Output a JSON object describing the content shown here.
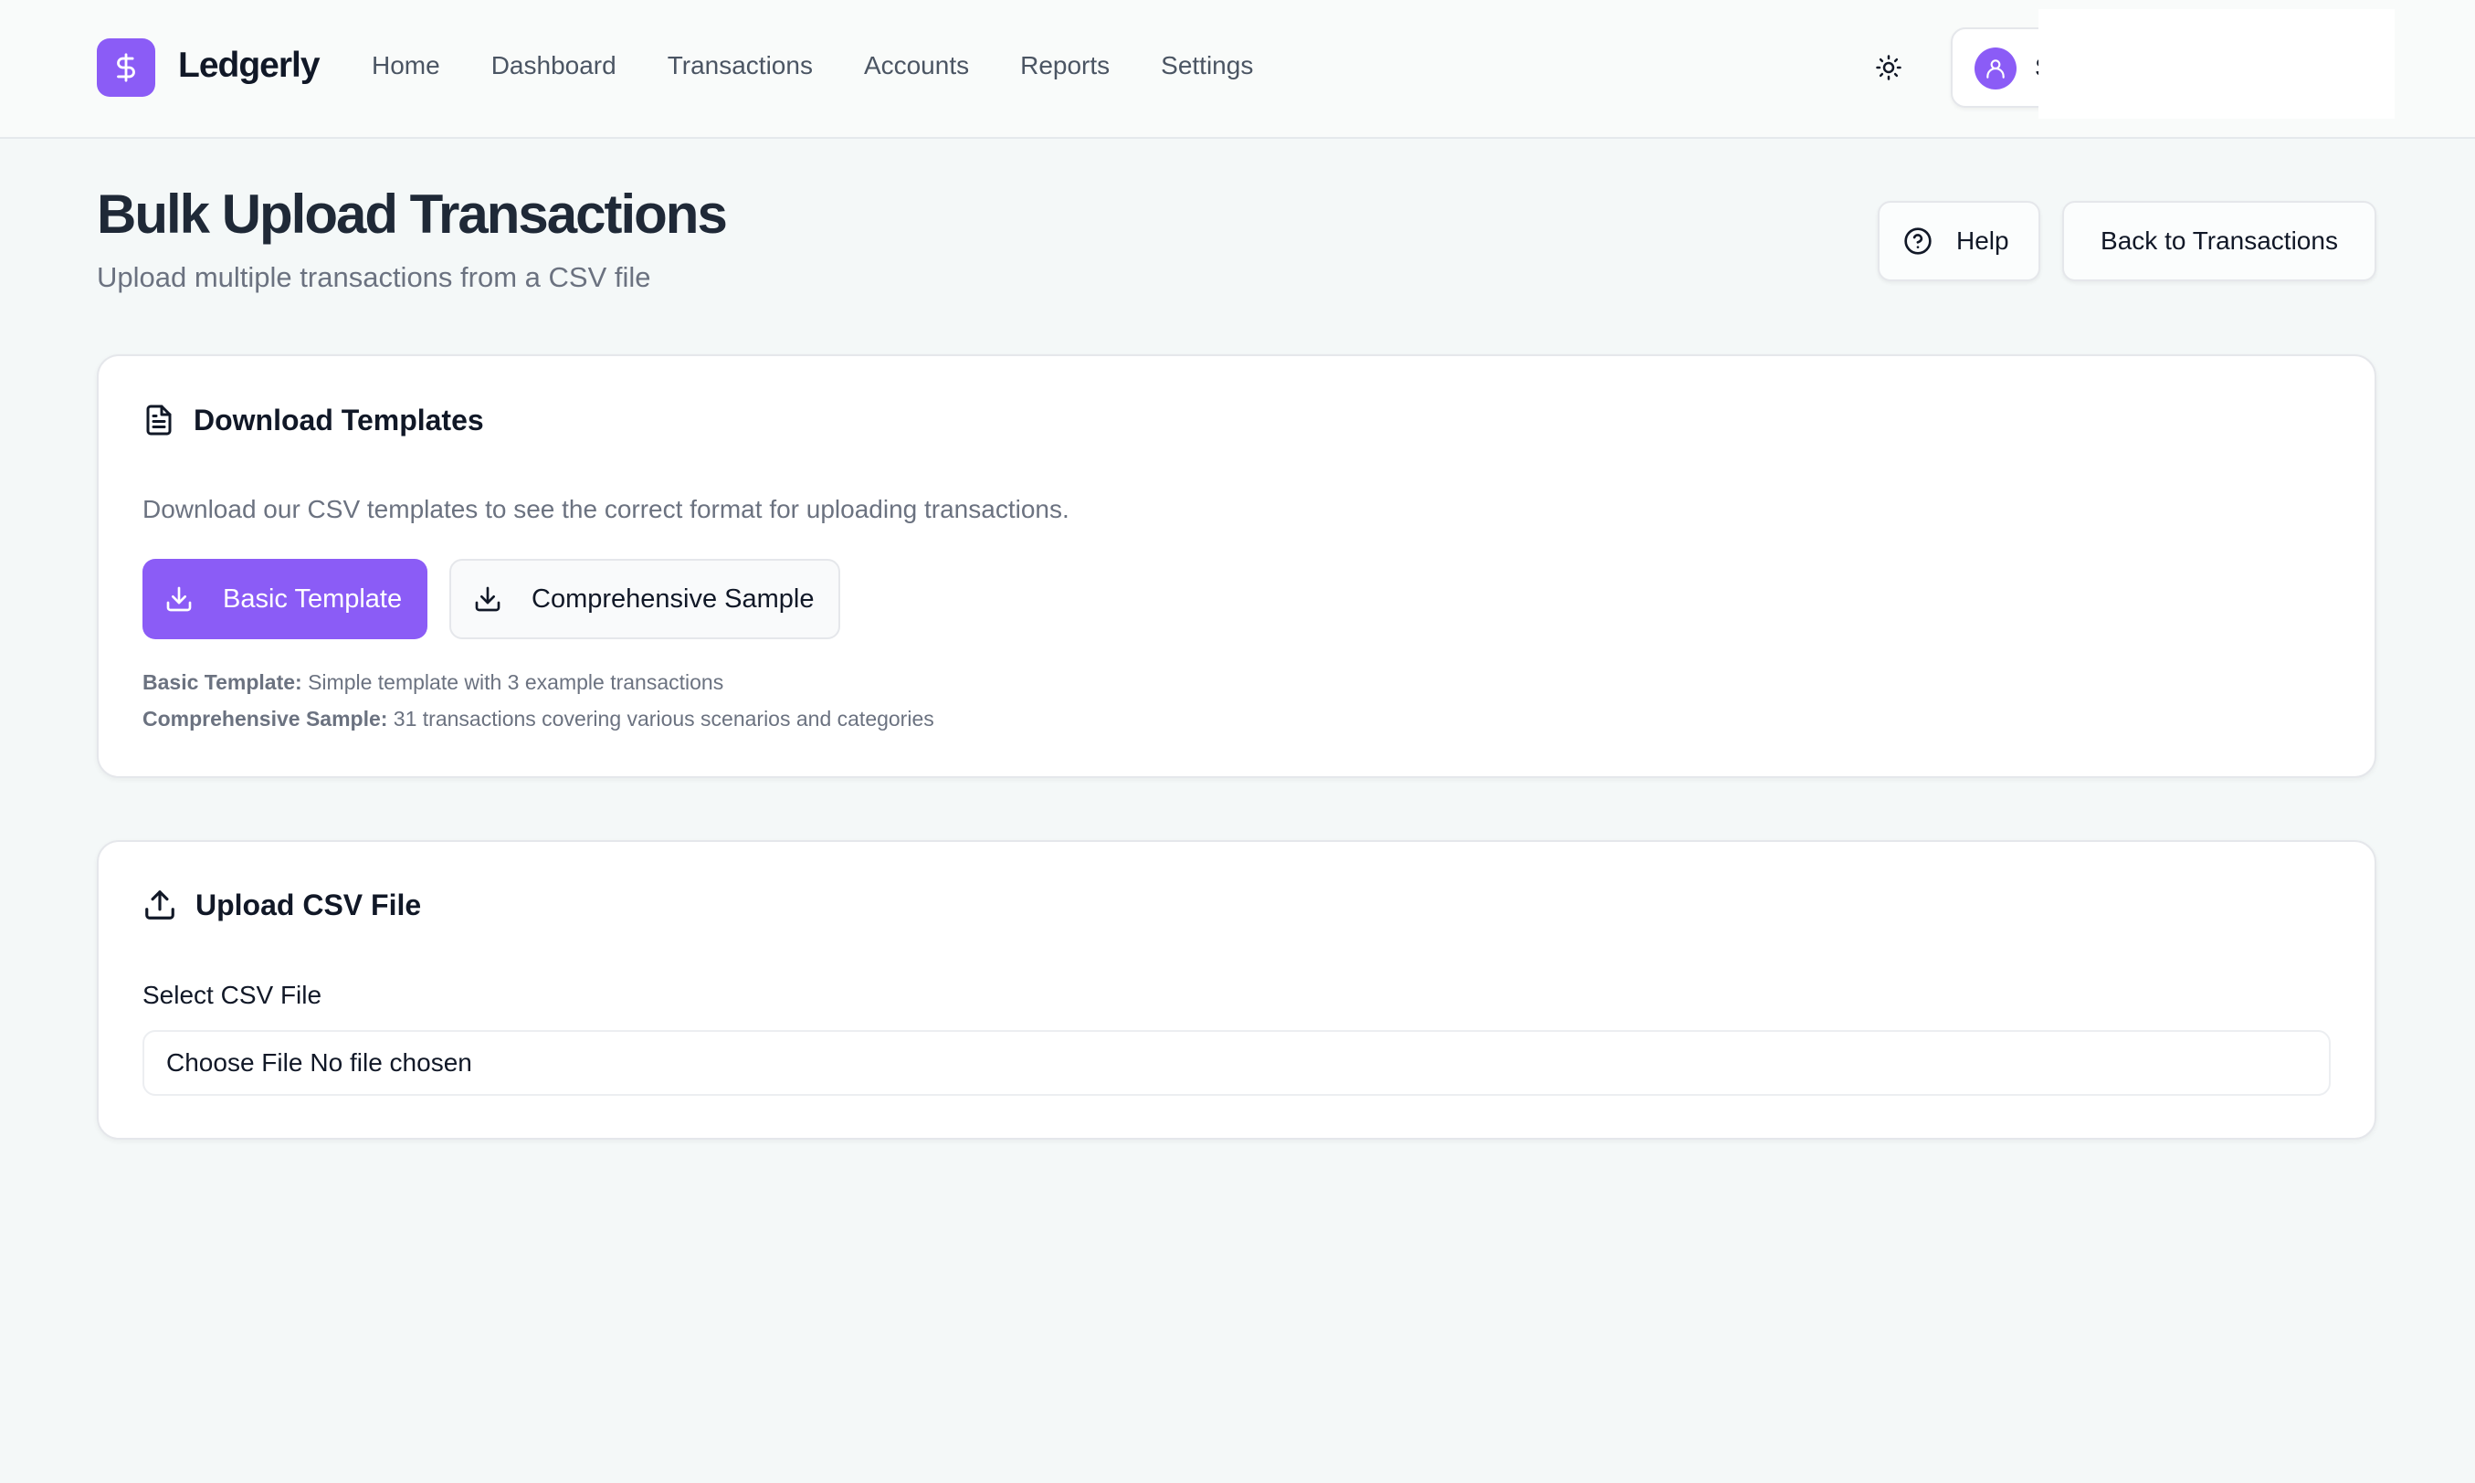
{
  "header": {
    "brand": "Ledgerly",
    "logo_icon": "dollar-icon",
    "nav": [
      "Home",
      "Dashboard",
      "Transactions",
      "Accounts",
      "Reports",
      "Settings"
    ],
    "theme_icon": "sun-icon",
    "user_initial": "S"
  },
  "page": {
    "title": "Bulk Upload Transactions",
    "subtitle": "Upload multiple transactions from a CSV file",
    "help_label": "Help",
    "back_label": "Back to Transactions"
  },
  "templates_card": {
    "title": "Download Templates",
    "description": "Download our CSV templates to see the correct format for uploading transactions.",
    "basic_button": "Basic Template",
    "comprehensive_button": "Comprehensive Sample",
    "notes": [
      {
        "term": "Basic Template:",
        "text": " Simple template with 3 example transactions"
      },
      {
        "term": "Comprehensive Sample:",
        "text": " 31 transactions covering various scenarios and categories"
      }
    ]
  },
  "upload_card": {
    "title": "Upload CSV File",
    "field_label": "Select CSV File",
    "choose_label": "Choose File",
    "file_status": "No file chosen"
  },
  "colors": {
    "accent": "#8b5cf6",
    "background": "#f4f8f8"
  }
}
